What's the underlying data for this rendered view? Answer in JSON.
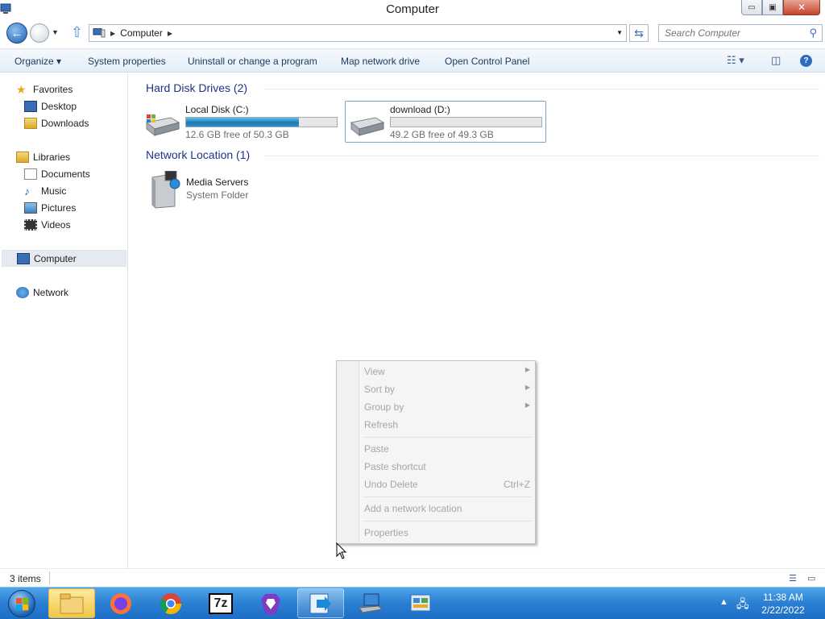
{
  "window": {
    "title": "Computer",
    "controls": {
      "minimize": "▭",
      "restore": "▣",
      "close": "✕"
    }
  },
  "address": {
    "crumbs": [
      "Computer"
    ],
    "search_placeholder": "Search Computer"
  },
  "commandbar": {
    "organize": "Organize ▾",
    "items": [
      "System properties",
      "Uninstall or change a program",
      "Map network drive",
      "Open Control Panel"
    ]
  },
  "navpane": {
    "favorites": {
      "label": "Favorites",
      "items": [
        "Desktop",
        "Downloads"
      ]
    },
    "libraries": {
      "label": "Libraries",
      "items": [
        "Documents",
        "Music",
        "Pictures",
        "Videos"
      ]
    },
    "computer": "Computer",
    "network": "Network"
  },
  "content": {
    "hard_disk_header": "Hard Disk Drives (2)",
    "drives": [
      {
        "name": "Local Disk (C:)",
        "free": "12.6 GB free of 50.3 GB",
        "used_fraction": 0.75
      },
      {
        "name": "download (D:)",
        "free": "49.2 GB free of 49.3 GB",
        "used_fraction": 0.002
      }
    ],
    "network_header": "Network Location (1)",
    "network_items": [
      {
        "name": "Media Servers",
        "type": "System Folder"
      }
    ]
  },
  "context_menu": {
    "view": "View",
    "sort_by": "Sort by",
    "group_by": "Group by",
    "refresh": "Refresh",
    "paste": "Paste",
    "paste_shortcut": "Paste shortcut",
    "undo_delete": "Undo Delete",
    "undo_shortcut": "Ctrl+Z",
    "add_network_location": "Add a network location",
    "properties": "Properties"
  },
  "statusbar": {
    "count": "3 items"
  },
  "taskbar": {
    "time": "11:38 AM",
    "date": "2/22/2022",
    "sevenzip_label": "7z"
  }
}
